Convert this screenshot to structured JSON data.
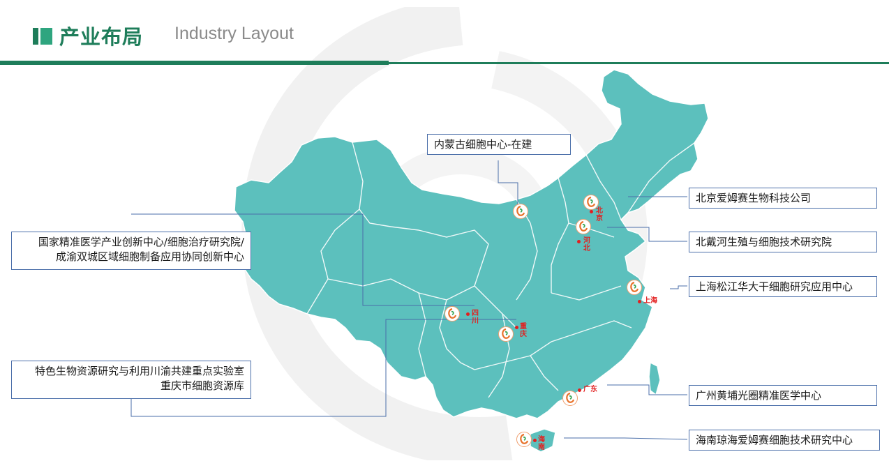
{
  "header": {
    "title_cn": "产业布局",
    "title_en": "Industry Layout"
  },
  "colors": {
    "brand_green": "#1e7d5a",
    "map_fill": "#5cc0bd",
    "border_line": "#4a6ea9",
    "city_red": "#e21f1f"
  },
  "labels": {
    "neimenggu": "内蒙古细胞中心-在建",
    "beijing_company": "北京爱姆赛生物科技公司",
    "beidaihe": "北戴河生殖与细胞技术研究院",
    "shanghai": "上海松江华大干细胞研究应用中心",
    "guangzhou": "广州黄埔光圈精准医学中心",
    "hainan": "海南琼海爱姆赛细胞技术研究中心",
    "sichuan_line1": "国家精准医学产业创新中心/细胞治疗研究院/",
    "sichuan_line2": "成渝双城区域细胞制备应用协同创新中心",
    "chongqing_line1": "特色生物资源研究与利用川渝共建重点实验室",
    "chongqing_line2": "重庆市细胞资源库"
  },
  "cities": {
    "beijing": "北京",
    "hebei": "河北",
    "shanghai": "上海",
    "sichuan": "四川",
    "chongqing": "重庆",
    "guangdong": "广东",
    "hainan": "海南"
  }
}
